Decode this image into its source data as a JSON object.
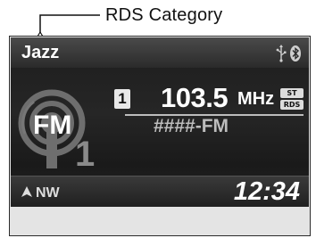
{
  "callout": {
    "label": "RDS Category"
  },
  "display": {
    "category": "Jazz",
    "preset": "1",
    "frequency": "103.5",
    "frequency_unit": "MHz",
    "badges": {
      "stereo": "ST",
      "rds": "RDS"
    },
    "station_name": "####-FM",
    "band_logo": {
      "text": "FM",
      "preset_digit": "1"
    },
    "compass": "NW",
    "clock": "12:34",
    "icons": [
      "usb-icon",
      "bluetooth-icon",
      "compass-arrow-icon"
    ]
  },
  "colors": {
    "screen_bg": "#202020",
    "text": "#ffffff",
    "muted_text": "#bdbdbd",
    "frame_bg": "#e4e4e4"
  }
}
